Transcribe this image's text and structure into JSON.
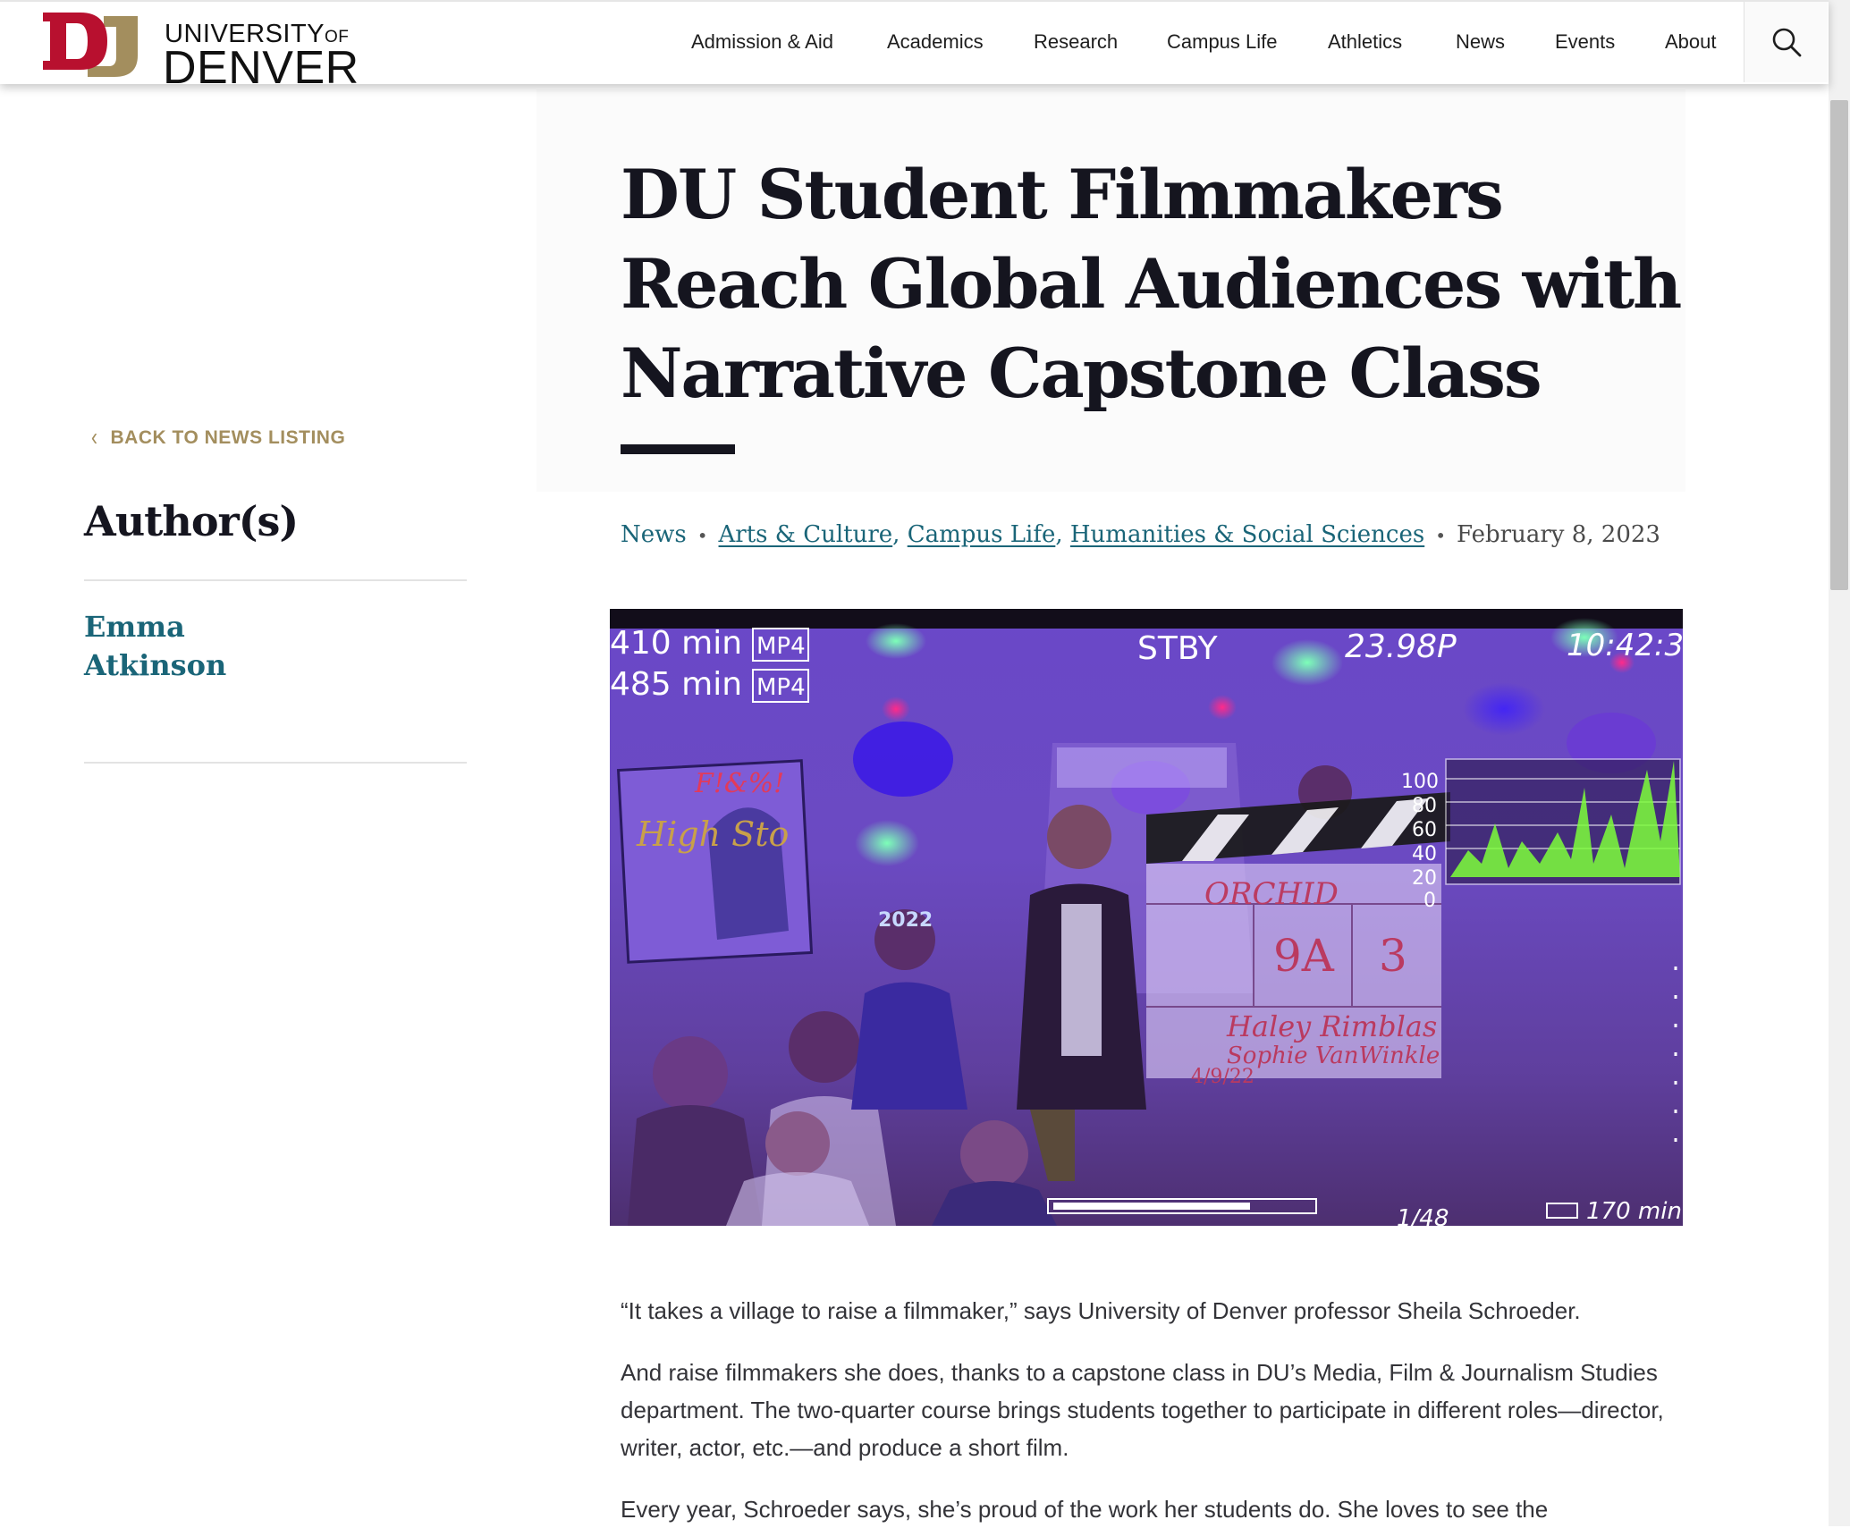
{
  "header": {
    "logo": {
      "monogram": "DU",
      "line1": "UNIVERSITY",
      "line1_suffix": "OF",
      "line2": "DENVER"
    },
    "nav": [
      {
        "label": "Admission & Aid"
      },
      {
        "label": "Academics"
      },
      {
        "label": "Research"
      },
      {
        "label": "Campus Life"
      },
      {
        "label": "Athletics"
      },
      {
        "label": "News"
      },
      {
        "label": "Events"
      },
      {
        "label": "About"
      }
    ],
    "search_icon": "search-icon"
  },
  "sidebar": {
    "back_link": "BACK TO NEWS LISTING",
    "authors_heading": "Author(s)",
    "authors": [
      {
        "first": "Emma",
        "last": "Atkinson"
      }
    ]
  },
  "article": {
    "title": "DU Student Filmmakers Reach Global Audiences with Narrative Capstone Class",
    "section": "News",
    "tags": [
      "Arts & Culture",
      "Campus Life",
      "Humanities & Social Sciences"
    ],
    "tag_separator": ",",
    "date": "February 8, 2023",
    "paragraphs": [
      "“It takes a village to raise a filmmaker,” says University of Denver professor Sheila Schroeder.",
      "And raise filmmakers she does, thanks to a capstone class in DU’s Media, Film & Journalism Studies department. The two-quarter course brings students together to participate in different roles—director, writer, actor, etc.—and produce a short film.",
      "Every year, Schroeder says, she’s proud of the work her students do. She loves to see the"
    ]
  },
  "photo": {
    "overlay": {
      "rec1": "410 min",
      "rec2": "485 min",
      "format": "MP4",
      "standby": "STBY",
      "framerate": "23.98P",
      "timecode": "10:42:3",
      "battery": "170 min",
      "shutter": "1/48",
      "waveform_scale": [
        "100",
        "80",
        "60",
        "40",
        "20",
        "0"
      ]
    },
    "clapper": {
      "production": "ORCHID",
      "scene": "9A",
      "take": "3",
      "director": "Haley Rimblas",
      "camera": "Sophie VanWinkle",
      "date": "4/9/22"
    },
    "poster_text": "F!&%!",
    "poster_title": "High Sto",
    "headband": "2022",
    "colors": {
      "accent": "#a38e5e",
      "link": "#1a6578",
      "brand_red": "#b8102f"
    }
  }
}
